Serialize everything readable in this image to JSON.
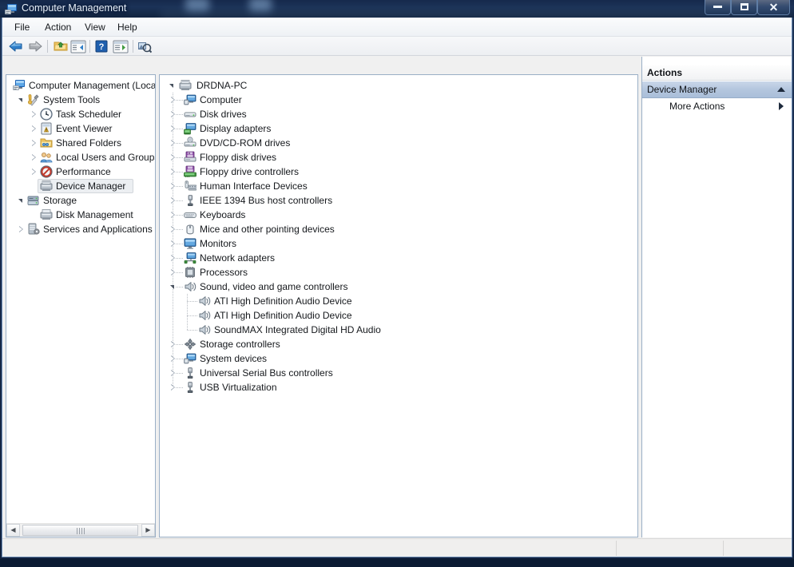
{
  "window": {
    "title": "Computer Management",
    "title_icon": "computer-management-icon",
    "minimize_label": "Minimize",
    "maximize_label": "Maximize",
    "close_label": "Close"
  },
  "menubar": {
    "items": [
      {
        "label": "File"
      },
      {
        "label": "Action"
      },
      {
        "label": "View"
      },
      {
        "label": "Help"
      }
    ]
  },
  "toolbar": {
    "buttons": [
      {
        "name": "back-icon",
        "tooltip": "Back"
      },
      {
        "name": "forward-icon",
        "tooltip": "Forward"
      },
      {
        "name": "up-folder-icon",
        "tooltip": "Up One Level"
      },
      {
        "name": "show-console-tree-icon",
        "tooltip": "Show/Hide Console Tree"
      },
      {
        "name": "help-icon",
        "tooltip": "Help"
      },
      {
        "name": "properties-icon",
        "tooltip": "Properties"
      },
      {
        "name": "refresh-icon",
        "tooltip": "Refresh"
      }
    ]
  },
  "console_tree": {
    "root": {
      "label": "Computer Management (Local",
      "icon": "computer-management-icon",
      "expanded": true
    },
    "items": [
      {
        "label": "System Tools",
        "icon": "system-tools-icon",
        "depth": 1,
        "state": "expanded",
        "selected": false
      },
      {
        "label": "Task Scheduler",
        "icon": "clock-icon",
        "depth": 2,
        "state": "collapsed",
        "selected": false
      },
      {
        "label": "Event Viewer",
        "icon": "event-viewer-icon",
        "depth": 2,
        "state": "collapsed",
        "selected": false
      },
      {
        "label": "Shared Folders",
        "icon": "shared-folders-icon",
        "depth": 2,
        "state": "collapsed",
        "selected": false
      },
      {
        "label": "Local Users and Groups",
        "icon": "users-group-icon",
        "depth": 2,
        "state": "collapsed",
        "selected": false
      },
      {
        "label": "Performance",
        "icon": "performance-icon",
        "depth": 2,
        "state": "collapsed",
        "selected": false
      },
      {
        "label": "Device Manager",
        "icon": "device-manager-icon",
        "depth": 2,
        "state": "leaf",
        "selected": true
      },
      {
        "label": "Storage",
        "icon": "storage-icon",
        "depth": 1,
        "state": "expanded",
        "selected": false
      },
      {
        "label": "Disk Management",
        "icon": "disk-management-icon",
        "depth": 2,
        "state": "leaf",
        "selected": false
      },
      {
        "label": "Services and Applications",
        "icon": "services-icon",
        "depth": 1,
        "state": "collapsed",
        "selected": false
      }
    ],
    "hscrollbar": {
      "left_arrow": "◀",
      "right_arrow": "▶"
    }
  },
  "device_tree": {
    "root": {
      "label": "DRDNA-PC",
      "icon": "computer-node-icon",
      "state": "expanded"
    },
    "items": [
      {
        "label": "Computer",
        "icon": "computer-icon",
        "depth": 1,
        "state": "collapsed"
      },
      {
        "label": "Disk drives",
        "icon": "disk-drive-icon",
        "depth": 1,
        "state": "collapsed"
      },
      {
        "label": "Display adapters",
        "icon": "display-adapter-icon",
        "depth": 1,
        "state": "collapsed"
      },
      {
        "label": "DVD/CD-ROM drives",
        "icon": "dvd-drive-icon",
        "depth": 1,
        "state": "collapsed"
      },
      {
        "label": "Floppy disk drives",
        "icon": "floppy-disk-icon",
        "depth": 1,
        "state": "collapsed"
      },
      {
        "label": "Floppy drive controllers",
        "icon": "floppy-controller-icon",
        "depth": 1,
        "state": "collapsed"
      },
      {
        "label": "Human Interface Devices",
        "icon": "hid-icon",
        "depth": 1,
        "state": "collapsed"
      },
      {
        "label": "IEEE 1394 Bus host controllers",
        "icon": "ieee1394-icon",
        "depth": 1,
        "state": "collapsed"
      },
      {
        "label": "Keyboards",
        "icon": "keyboard-icon",
        "depth": 1,
        "state": "collapsed"
      },
      {
        "label": "Mice and other pointing devices",
        "icon": "mouse-icon",
        "depth": 1,
        "state": "collapsed"
      },
      {
        "label": "Monitors",
        "icon": "monitor-icon",
        "depth": 1,
        "state": "collapsed"
      },
      {
        "label": "Network adapters",
        "icon": "network-adapter-icon",
        "depth": 1,
        "state": "collapsed"
      },
      {
        "label": "Processors",
        "icon": "processor-icon",
        "depth": 1,
        "state": "collapsed"
      },
      {
        "label": "Sound, video and game controllers",
        "icon": "speaker-icon",
        "depth": 1,
        "state": "expanded"
      },
      {
        "label": "ATI High Definition Audio Device",
        "icon": "speaker-icon",
        "depth": 2,
        "state": "leaf"
      },
      {
        "label": "ATI High Definition Audio Device",
        "icon": "speaker-icon",
        "depth": 2,
        "state": "leaf"
      },
      {
        "label": "SoundMAX Integrated Digital HD Audio",
        "icon": "speaker-icon",
        "depth": 2,
        "state": "leaf"
      },
      {
        "label": "Storage controllers",
        "icon": "storage-controller-icon",
        "depth": 1,
        "state": "collapsed"
      },
      {
        "label": "System devices",
        "icon": "system-device-icon",
        "depth": 1,
        "state": "collapsed"
      },
      {
        "label": "Universal Serial Bus controllers",
        "icon": "usb-icon",
        "depth": 1,
        "state": "collapsed"
      },
      {
        "label": "USB Virtualization",
        "icon": "usb-icon",
        "depth": 1,
        "state": "collapsed"
      }
    ]
  },
  "actions_pane": {
    "header": "Actions",
    "group": {
      "label": "Device Manager",
      "collapse_icon": "chevron-up-icon"
    },
    "more": {
      "label": "More Actions",
      "arrow_icon": "chevron-right-icon"
    }
  },
  "statusbar": {
    "cells": [
      "",
      "",
      ""
    ]
  },
  "colors": {
    "titlebar": "#17294a",
    "selection_inactive": "#eceff2",
    "actions_group": "#b4c6de",
    "pane_border": "#9aafc6"
  }
}
